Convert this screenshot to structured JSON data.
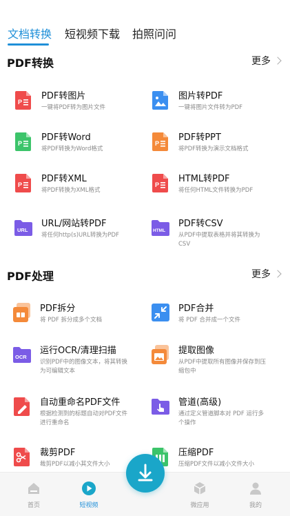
{
  "tabs": [
    {
      "label": "文档转换",
      "active": true
    },
    {
      "label": "短视频下载",
      "active": false
    },
    {
      "label": "拍照问问",
      "active": false
    }
  ],
  "pdf_convert": {
    "title": "PDF转换",
    "more": "更多",
    "items": [
      {
        "title": "PDF转图片",
        "desc": "一键将PDF转为图片文件",
        "icon": "pdf-file-icon"
      },
      {
        "title": "图片转PDF",
        "desc": "一键将图片文件转为PDF",
        "icon": "image-file-icon"
      },
      {
        "title": "PDF转Word",
        "desc": "将PDF转换为Word格式",
        "icon": "word-file-icon"
      },
      {
        "title": "PDF转PPT",
        "desc": "将PDF转换为演示文档格式",
        "icon": "ppt-file-icon"
      },
      {
        "title": "PDF转XML",
        "desc": "将PDF转换为XML格式",
        "icon": "xml-file-icon"
      },
      {
        "title": "HTML转PDF",
        "desc": "将任何HTML文件转换为PDF",
        "icon": "html-file-icon"
      },
      {
        "title": "URL/网站转PDF",
        "desc": "将任何http(s)URL转换为PDF",
        "icon": "url-folder-icon"
      },
      {
        "title": "PDF转CSV",
        "desc": "从PDF中提取表格并将其转换为CSV",
        "icon": "csv-folder-icon"
      }
    ]
  },
  "pdf_process": {
    "title": "PDF处理",
    "more": "更多",
    "items": [
      {
        "title": "PDF拆分",
        "desc": "将 PDF 拆分成多个文档",
        "icon": "split-icon"
      },
      {
        "title": "PDF合并",
        "desc": "将 PDF 合并成一个文件",
        "icon": "merge-icon"
      },
      {
        "title": "运行OCR/清理扫描",
        "desc": "识别PDF中的图像文本，将其转换为可编辑文本",
        "icon": "ocr-folder-icon"
      },
      {
        "title": "提取图像",
        "desc": "从PDF中提取所有图像并保存到压缩包中",
        "icon": "extract-image-icon"
      },
      {
        "title": "自动重命名PDF文件",
        "desc": "根据检测到的标题自动对PDF文件进行重命名",
        "icon": "rename-folder-icon"
      },
      {
        "title": "管道(高级)",
        "desc": "通过定义管道脚本对 PDF 运行多个操作",
        "icon": "pipeline-folder-icon"
      },
      {
        "title": "裁剪PDF",
        "desc": "裁剪PDF以减小其文件大小",
        "icon": "crop-icon"
      },
      {
        "title": "压缩PDF",
        "desc": "压缩PDF文件以减小文件大小",
        "icon": "compress-icon"
      }
    ]
  },
  "bottom_nav": [
    {
      "label": "首页",
      "icon": "home-icon",
      "active": false
    },
    {
      "label": "短视频",
      "icon": "play-icon",
      "active": true
    },
    {
      "label": "",
      "icon": "download-icon",
      "active": false
    },
    {
      "label": "微应用",
      "icon": "cube-icon",
      "active": false
    },
    {
      "label": "我的",
      "icon": "user-icon",
      "active": false
    }
  ],
  "colors": {
    "accent": "#1f8fd8",
    "pdf_red": "#ef4b4b",
    "word_green": "#3cc46a",
    "ppt_orange": "#f48a3a",
    "folder_purple": "#7b5ce6",
    "image_blue": "#3b8ff0",
    "fab_teal": "#1aa6c9"
  }
}
